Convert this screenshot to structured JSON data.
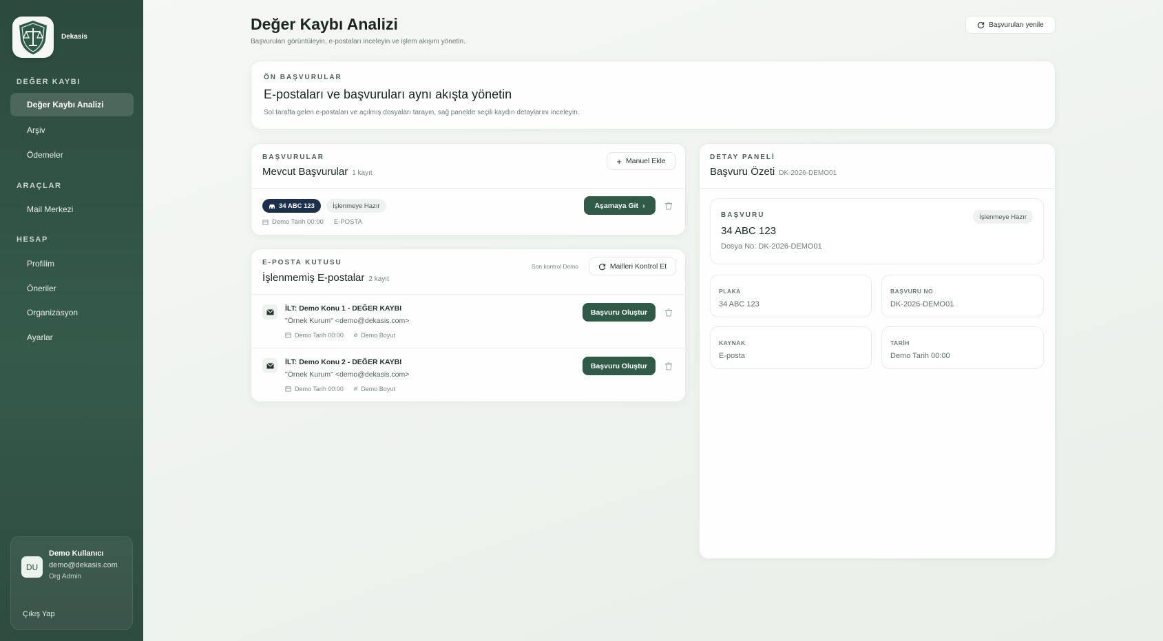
{
  "sidebar": {
    "brand": "Dekasis",
    "sections": [
      {
        "title": "DEĞER KAYBI",
        "items": [
          "Değer Kaybı Analizi",
          "Arşiv",
          "Ödemeler"
        ]
      },
      {
        "title": "ARAÇLAR",
        "items": [
          "Mail Merkezi"
        ]
      },
      {
        "title": "HESAP",
        "items": [
          "Profilim",
          "Öneriler",
          "Organizasyon",
          "Ayarlar"
        ]
      }
    ],
    "active_item": "Değer Kaybı Analizi",
    "user": {
      "initials": "DU",
      "name": "Demo Kullanıcı",
      "email": "demo@dekasis.com",
      "role": "Org Admin",
      "logout": "Çıkış Yap"
    }
  },
  "header": {
    "title": "Değer Kaybı Analizi",
    "subtitle": "Başvuruları görüntüleyin, e-postaları inceleyin ve işlem akışını yönetin.",
    "refresh_label": "Başvuruları yenile"
  },
  "hero": {
    "eyebrow": "ÖN BAŞVURULAR",
    "title": "E-postaları ve başvuruları aynı akışta yönetin",
    "description": "Sol tarafta gelen e-postaları ve açılmış dosyaları tarayın, sağ panelde seçili kaydın detaylarını inceleyin."
  },
  "applications": {
    "eyebrow": "BAŞVURULAR",
    "title": "Mevcut Başvurular",
    "count": "1 kayıt",
    "add_label": "Manuel Ekle",
    "items": [
      {
        "plate": "34 ABC 123",
        "status": "İşlenmeye Hazır",
        "date": "Demo Tarih 00:00",
        "source": "E-POSTA",
        "action": "Aşamaya Git"
      }
    ]
  },
  "inbox": {
    "eyebrow": "E-POSTA KUTUSU",
    "title": "İşlenmemiş E-postalar",
    "count": "2 kayıt",
    "last_check": "Son kontrol Demo",
    "check_label": "Mailleri Kontrol Et",
    "items": [
      {
        "subject": "İLT: Demo Konu 1 - DEĞER KAYBI",
        "from": "\"Örnek Kurum\" <demo@dekasis.com>",
        "date": "Demo Tarih 00:00",
        "size": "Demo Boyut",
        "action": "Başvuru Oluştur"
      },
      {
        "subject": "İLT: Demo Konu 2 - DEĞER KAYBI",
        "from": "\"Örnek Kurum\" <demo@dekasis.com>",
        "date": "Demo Tarih 00:00",
        "size": "Demo Boyut",
        "action": "Başvuru Oluştur"
      }
    ]
  },
  "detail": {
    "eyebrow": "DETAY PANELİ",
    "title": "Başvuru Özeti",
    "file_code": "DK-2026-DEMO01",
    "summary": {
      "eyebrow": "BAŞVURU",
      "plate": "34 ABC 123",
      "file_no": "Dosya No: DK-2026-DEMO01",
      "status": "İşlenmeye Hazır"
    },
    "fields": [
      {
        "label": "PLAKA",
        "value": "34 ABC 123"
      },
      {
        "label": "BAŞVURU NO",
        "value": "DK-2026-DEMO01"
      },
      {
        "label": "KAYNAK",
        "value": "E-posta"
      },
      {
        "label": "TARİH",
        "value": "Demo Tarih 00:00"
      }
    ]
  },
  "colors": {
    "sidebar": "#2c4a3e",
    "primary_button": "#2f5a47",
    "plate_badge": "#1d2f4a"
  }
}
